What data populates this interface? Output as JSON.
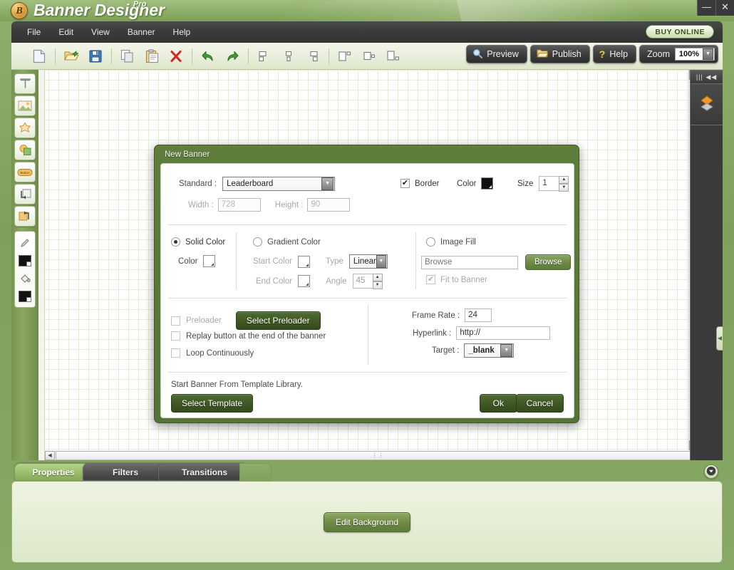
{
  "app": {
    "title": "Banner Designer",
    "title_sup": "Pro",
    "logo_glyph": "B"
  },
  "window_controls": {
    "minimize": "—",
    "close": "✕"
  },
  "menubar": {
    "items": [
      "File",
      "Edit",
      "View",
      "Banner",
      "Help"
    ],
    "buy_online": "BUY ONLINE"
  },
  "toolbar": {
    "icons": [
      "new-document-icon",
      "open-folder-icon",
      "save-disk-icon",
      "copy-icon",
      "paste-icon",
      "delete-x-icon",
      "undo-arrow-icon",
      "redo-arrow-icon",
      "align-left-icon",
      "align-center-icon",
      "align-right-icon",
      "align-top-icon",
      "align-middle-icon",
      "align-bottom-icon"
    ],
    "preview_label": "Preview",
    "publish_label": "Publish",
    "help_label": "Help",
    "zoom_label": "Zoom",
    "zoom_value": "100%"
  },
  "left_tools": {
    "items": [
      "text-tool-icon",
      "image-tool-icon",
      "shape-star-tool-icon",
      "shape-overlap-tool-icon",
      "button-tool-icon",
      "rotate-left-tool-icon",
      "rotate-right-tool-icon"
    ],
    "color_tools": [
      "pencil-icon",
      "foreground-color-swatch",
      "fill-bucket-icon",
      "background-color-swatch"
    ]
  },
  "right_dock": {
    "header_glyph": "||| ◀◀",
    "layer_icon": "layers-diamond-icon"
  },
  "scrollbars": {
    "up": "▲",
    "down": "▼",
    "left": "◀",
    "right": "▶",
    "grip": "⋮⋮"
  },
  "tabs": {
    "items": [
      {
        "label": "Properties",
        "active": true
      },
      {
        "label": "Filters",
        "active": false
      },
      {
        "label": "Transitions",
        "active": false
      }
    ],
    "collapse_icon": "chevron-down-icon"
  },
  "properties_panel": {
    "edit_background_label": "Edit Background"
  },
  "dialog": {
    "title": "New Banner",
    "size_section": {
      "standard_label": "Standard :",
      "standard_value": "Leaderboard",
      "width_label": "Width :",
      "width_value": "728",
      "height_label": "Height :",
      "height_value": "90",
      "border_label": "Border",
      "border_checked": "✔",
      "color_label": "Color",
      "border_color": "#111111",
      "size_label": "Size",
      "size_value": "1"
    },
    "fill_section": {
      "solid_color_label": "Solid Color",
      "solid_color_selected": true,
      "color_label": "Color",
      "gradient_color_label": "Gradient Color",
      "start_color_label": "Start Color",
      "end_color_label": "End Color",
      "type_label": "Type",
      "type_value": "Linear",
      "angle_label": "Angle",
      "angle_value": "45",
      "image_fill_label": "Image Fill",
      "browse_placeholder": "Browse",
      "browse_button": "Browse",
      "fit_to_banner_label": "Fit to Banner",
      "fit_checked": "✔"
    },
    "playback_section": {
      "preloader_label": "Preloader",
      "select_preloader_button": "Select Preloader",
      "replay_label": "Replay button at the end of the banner",
      "loop_label": "Loop Continuously",
      "frame_rate_label": "Frame Rate :",
      "frame_rate_value": "24",
      "hyperlink_label": "Hyperlink :",
      "hyperlink_value": "http://",
      "target_label": "Target :",
      "target_value": "_blank"
    },
    "template_section": {
      "hint": "Start Banner From Template Library.",
      "select_template_button": "Select Template",
      "ok_button": "Ok",
      "cancel_button": "Cancel"
    }
  }
}
